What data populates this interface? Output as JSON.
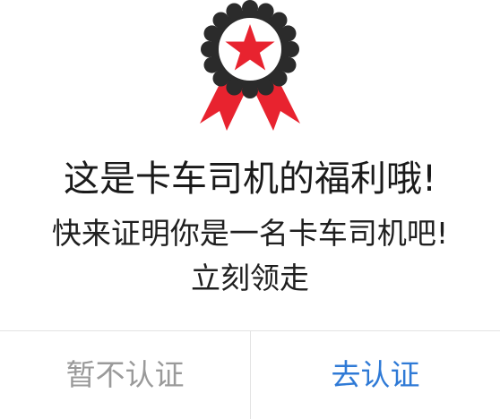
{
  "dialog": {
    "icon": "award-ribbon-icon",
    "title": "这是卡车司机的福利哦!",
    "message_line1": "快来证明你是一名卡车司机吧!",
    "message_line2": "立刻领走",
    "cancel_label": "暂不认证",
    "confirm_label": "去认证"
  },
  "colors": {
    "badge_dark": "#2b2b2b",
    "accent_red": "#e8232f",
    "cancel_text": "#9a9a9a",
    "confirm_text": "#2f7ad6"
  }
}
